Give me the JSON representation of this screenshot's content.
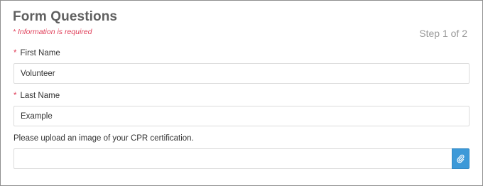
{
  "form": {
    "title": "Form Questions",
    "required_note": "* Information is required",
    "step": "Step 1 of 2"
  },
  "fields": {
    "first_name": {
      "required_mark": "*",
      "label": "First Name",
      "value": "Volunteer"
    },
    "last_name": {
      "required_mark": "*",
      "label": "Last Name",
      "value": "Example"
    },
    "upload": {
      "label": "Please upload an image of your CPR certification.",
      "value": "",
      "button_icon": "paperclip-icon"
    }
  },
  "colors": {
    "accent": "#3c99d8",
    "required": "#e0405a",
    "title": "#5f5f5f"
  }
}
